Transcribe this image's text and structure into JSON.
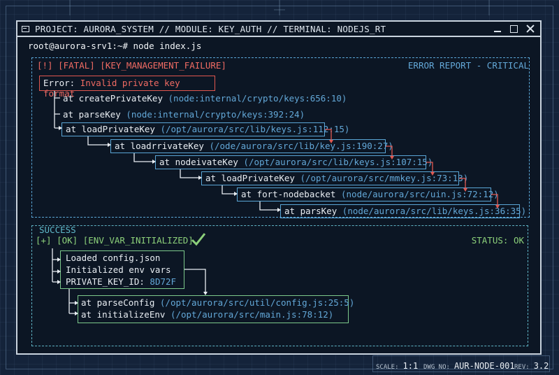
{
  "window": {
    "title": "PROJECT: AURORA_SYSTEM // MODULE: KEY_AUTH // TERMINAL: NODEJS_RT",
    "prompt": "root@aurora-srv1:~# node index.js"
  },
  "error": {
    "tag": "[!] [FATAL] [KEY_MANAGEMENT_FAILURE]",
    "report_label": "ERROR REPORT - CRITICAL",
    "message_prefix": "Error:",
    "message": "Invalid private key format",
    "frames": [
      {
        "fn": "at createPrivateKey",
        "loc": "(node:internal/crypto/keys:656:10)"
      },
      {
        "fn": "at parseKey",
        "loc": "(node:internal/crypto/keys:392:24)"
      },
      {
        "fn": "at loadPrivateKey",
        "loc": "(/opt/aurora/src/lib/keys.js:112:15)"
      },
      {
        "fn": "at loadrrivateKey",
        "loc": "(/ode/aurora/src/lib/key.js:190:27)"
      },
      {
        "fn": "at nodeivateKey",
        "loc": "(/opt/aurora/src/lib/keys.js:107:15)"
      },
      {
        "fn": "at loadPrivateKey",
        "loc": "(/opt/aurora/src/mmkey.js:73:13)"
      },
      {
        "fn": "at fort-nodebacket",
        "loc": "(node/aurora/src/uin.js:72:12)"
      },
      {
        "fn": "at parsKey",
        "loc": "(node/aurora/src/lib/keys.js:36:35)"
      }
    ]
  },
  "success": {
    "label": "SUCCESS",
    "tag_plus": "[+]",
    "tag_ok": "[OK]",
    "tag_env": "[ENV_VAR_INITIALIZED]",
    "status": "STATUS: OK",
    "lines": [
      "Loaded config.json",
      "Initialized env vars",
      "PRIVATE_KEY_ID:"
    ],
    "key_id": "8D72F",
    "frames": [
      {
        "fn": "at parseConfig",
        "loc": "(/opt/aurora/src/util/config.js:25:5)"
      },
      {
        "fn": "at initializeEnv",
        "loc": "(/opt/aurora/src/main.js:78:12)"
      }
    ]
  },
  "footer": {
    "scale_label": "SCALE:",
    "scale": "1:1",
    "dwg_label": "DWG NO:",
    "dwg": "AUR-NODE-001",
    "rev_label": "REV:",
    "rev": "3.2"
  },
  "colors": {
    "accent_blue": "#5aa6d6",
    "error_red": "#e2574f",
    "ok_green": "#8cd07a"
  }
}
